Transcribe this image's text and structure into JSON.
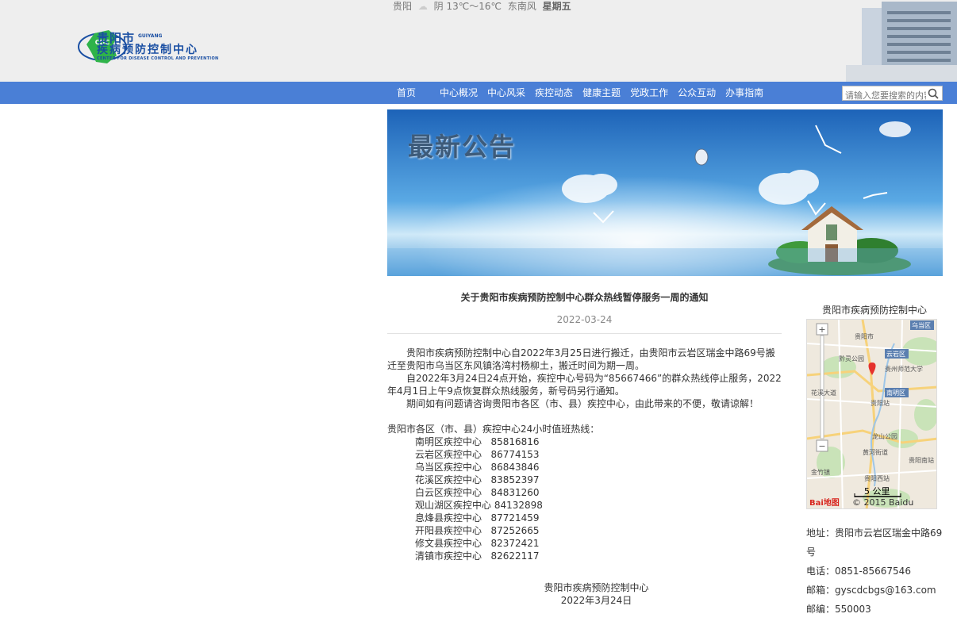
{
  "weather": {
    "city": "贵阳",
    "condition": "阴 13℃～16℃",
    "wind": "东南风",
    "weekday": "星期五"
  },
  "logo": {
    "badge": "CDC",
    "city_cn": "贵阳市",
    "city_en": "GUIYANG",
    "name_cn": "疾病预防控制中心",
    "name_en": "CENTER FOR DISEASE CONTROL AND PREVENTION"
  },
  "nav": {
    "items": [
      "首页",
      "中心概况",
      "中心风采",
      "疾控动态",
      "健康主题",
      "党政工作",
      "公众互动",
      "办事指南"
    ]
  },
  "search": {
    "placeholder": "请输入您要搜索的内容"
  },
  "banner": {
    "title": "最新公告"
  },
  "article": {
    "title": "关于贵阳市疾病预防控制中心群众热线暂停服务一周的通知",
    "date": "2022-03-24",
    "paragraphs": [
      "贵阳市疾病预防控制中心自2022年3月25日进行搬迁，由贵阳市云岩区瑞金中路69号搬迁至贵阳市乌当区东风镇洛湾村杨柳土，搬迁时间为期一周。",
      "自2022年3月24日24点开始，疾控中心号码为“85667466”的群众热线停止服务，2022年4月1日上午9点恢复群众热线服务，新号码另行通知。",
      "期间如有问题请咨询贵阳市各区（市、县）疾控中心，由此带来的不便，敬请谅解！"
    ],
    "hotline_title": "贵阳市各区（市、县）疾控中心24小时值班热线：",
    "hotlines": [
      {
        "name": "南明区疾控中心",
        "phone": "85816816"
      },
      {
        "name": "云岩区疾控中心",
        "phone": "86774153"
      },
      {
        "name": "乌当区疾控中心",
        "phone": "86843846"
      },
      {
        "name": "花溪区疾控中心",
        "phone": "83852397"
      },
      {
        "name": "白云区疾控中心",
        "phone": "84831260"
      },
      {
        "name": "观山湖区疾控中心",
        "phone": "84132898"
      },
      {
        "name": "息烽县疾控中心",
        "phone": "87721459"
      },
      {
        "name": "开阳县疾控中心",
        "phone": "87252665"
      },
      {
        "name": "修文县疾控中心",
        "phone": "82372421"
      },
      {
        "name": "清镇市疾控中心",
        "phone": "82622117"
      }
    ],
    "signature": "贵阳市疾病预防控制中心",
    "signature_date": "2022年3月24日"
  },
  "sidebar": {
    "map_title": "贵阳市疾病预防控制中心",
    "map": {
      "labels": [
        "乌当区",
        "云岩区",
        "南明区",
        "贵阳市",
        "黔灵公园",
        "贵州师范大学",
        "花溪大道",
        "贵阳站",
        "龙山公园",
        "贵阳南站",
        "黄河街道",
        "金竹镇",
        "贵阳西站"
      ],
      "scale": "5 公里",
      "copyright": "© 2015 Baidu",
      "brand": "Bai地图"
    },
    "address": "地址：贵阳市云岩区瑞金中路69号",
    "phone": "电话：0851-85667546",
    "email": "邮箱：gyscdcbgs@163.com",
    "postcode": "邮编：550003"
  },
  "colors": {
    "nav_bg": "#4a7fd6",
    "header_bg": "#eeeeee",
    "logo_blue": "#1a4fa3",
    "logo_green": "#2fb34a"
  }
}
